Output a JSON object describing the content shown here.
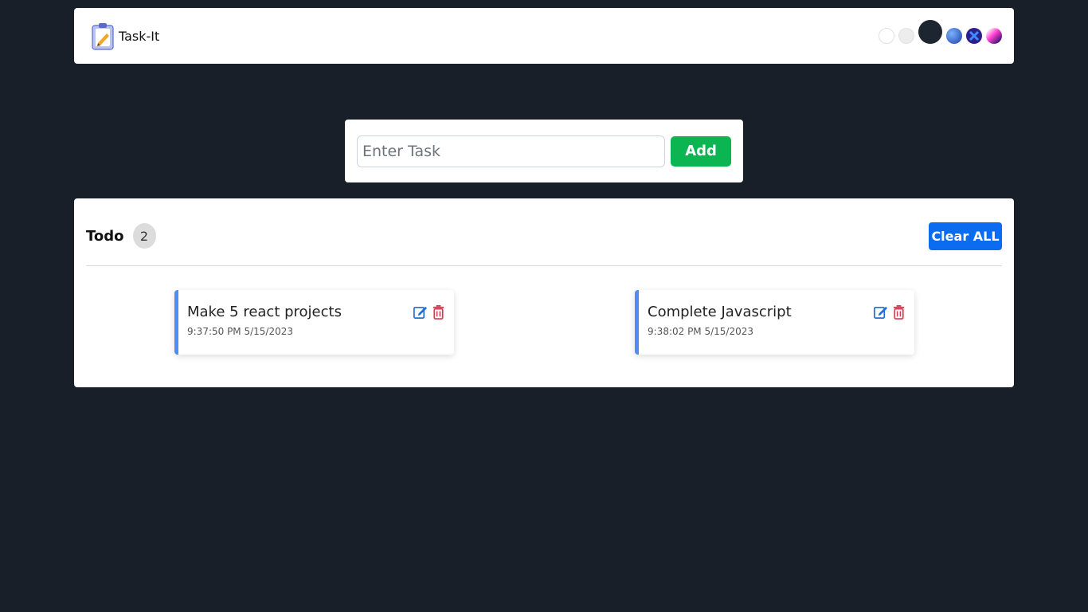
{
  "header": {
    "title": "Task-It",
    "logo_icon": "clipboard-pencil-icon",
    "themes": [
      {
        "name": "light",
        "color": "#ffffff"
      },
      {
        "name": "gray",
        "color": "#eeeeee"
      },
      {
        "name": "dark",
        "color": "#1c2530",
        "active": true
      },
      {
        "name": "blue",
        "color": "#2a5fd0"
      },
      {
        "name": "cross",
        "color": "#3a2db8"
      },
      {
        "name": "pink",
        "color": "#e040c0"
      }
    ]
  },
  "form": {
    "placeholder": "Enter Task",
    "value": "",
    "add_label": "Add",
    "add_color": "#0bb652"
  },
  "todo": {
    "title": "Todo",
    "count": "2",
    "clear_label": "Clear ALL",
    "clear_color": "#0b6cf0",
    "tasks": [
      {
        "name": "Make 5 react projects",
        "time": "9:37:50 PM 5/15/2023"
      },
      {
        "name": "Complete Javascript",
        "time": "9:38:02 PM 5/15/2023"
      }
    ],
    "accent_color": "#4f8ef0"
  }
}
